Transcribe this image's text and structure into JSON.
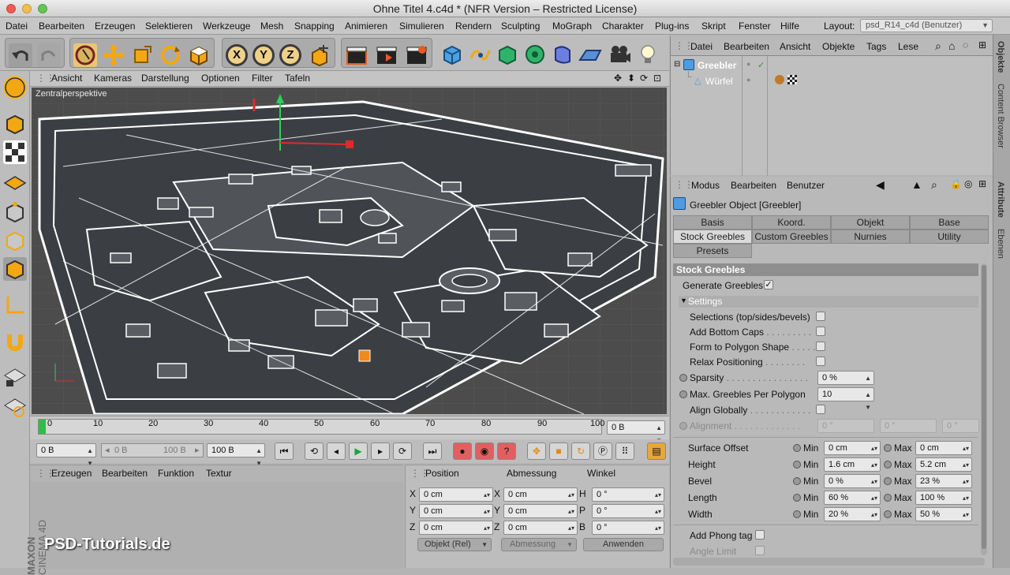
{
  "window": {
    "title": "Ohne Titel 4.c4d * (NFR Version – Restricted License)",
    "menu": [
      "Datei",
      "Bearbeiten",
      "Erzeugen",
      "Selektieren",
      "Werkzeuge",
      "Mesh",
      "Snapping",
      "Animieren",
      "Simulieren",
      "Rendern",
      "Sculpting",
      "MoGraph",
      "Charakter",
      "Plug-ins",
      "Skript",
      "Fenster",
      "Hilfe"
    ],
    "layout_label": "Layout:",
    "layout_value": "psd_R14_c4d (Benutzer)"
  },
  "toolbar": {
    "axis_x": "X",
    "axis_y": "Y",
    "axis_z": "Z"
  },
  "viewport": {
    "menu": [
      "Ansicht",
      "Kameras",
      "Darstellung",
      "Optionen",
      "Filter",
      "Tafeln"
    ],
    "label": "Zentralperspektive"
  },
  "timeline": {
    "ticks": [
      "0",
      "10",
      "20",
      "30",
      "40",
      "50",
      "60",
      "70",
      "80",
      "90",
      "100"
    ],
    "frame_display": "0 B"
  },
  "playback": {
    "start": "0 B",
    "range_min": "0 B",
    "range_max": "100 B",
    "end": "100 B"
  },
  "material_manager": {
    "menu": [
      "Erzeugen",
      "Bearbeiten",
      "Funktion",
      "Textur"
    ],
    "brand_line1": "MAXON",
    "brand_line2": "CINEMA 4D",
    "watermark": "PSD-Tutorials.de"
  },
  "coord_manager": {
    "headers": [
      "Position",
      "Abmessung",
      "Winkel"
    ],
    "rows": [
      {
        "pl": "X",
        "pv": "0 cm",
        "sl": "X",
        "sv": "0 cm",
        "al": "H",
        "av": "0 °"
      },
      {
        "pl": "Y",
        "pv": "0 cm",
        "sl": "Y",
        "sv": "0 cm",
        "al": "P",
        "av": "0 °"
      },
      {
        "pl": "Z",
        "pv": "0 cm",
        "sl": "Z",
        "sv": "0 cm",
        "al": "B",
        "av": "0 °"
      }
    ],
    "mode": "Objekt (Rel)",
    "size_mode": "Abmessung",
    "apply": "Anwenden"
  },
  "object_manager": {
    "menu": [
      "Datei",
      "Bearbeiten",
      "Ansicht",
      "Objekte",
      "Tags",
      "Lese"
    ],
    "objects": [
      {
        "name": "Greebler",
        "selected": true
      },
      {
        "name": "Würfel",
        "selected": false
      }
    ]
  },
  "attribute_manager": {
    "menu": [
      "Modus",
      "Bearbeiten",
      "Benutzer"
    ],
    "object_title": "Greebler Object [Greebler]",
    "tabs_row1": [
      "Basis",
      "Koord.",
      "Objekt",
      "Base"
    ],
    "tabs_row2": [
      "Stock Greebles",
      "Custom Greebles",
      "Nurnies",
      "Utility"
    ],
    "tabs_row3": [
      "Presets"
    ],
    "active_tab": "Stock Greebles",
    "section": "Stock Greebles",
    "generate_label": "Generate Greebles",
    "settings_label": "Settings",
    "options": [
      {
        "label": "Selections (top/sides/bevels)",
        "checked": false
      },
      {
        "label": "Add Bottom Caps",
        "checked": false
      },
      {
        "label": "Form to Polygon Shape",
        "checked": false
      },
      {
        "label": "Relax Positioning",
        "checked": false
      }
    ],
    "sparsity_label": "Sparsity",
    "sparsity_value": "0 %",
    "max_greebles_label": "Max. Greebles Per Polygon",
    "max_greebles_value": "10",
    "align_globally_label": "Align Globally",
    "alignment_label": "Alignment",
    "alignment_values": [
      "0 °",
      "0 °",
      "0 °"
    ],
    "min_label": "Min",
    "max_label": "Max",
    "ranges": [
      {
        "label": "Surface Offset",
        "min": "0 cm",
        "max": "0 cm"
      },
      {
        "label": "Height",
        "min": "1.6 cm",
        "max": "5.2 cm"
      },
      {
        "label": "Bevel",
        "min": "0 %",
        "max": "23 %"
      },
      {
        "label": "Length",
        "min": "60 %",
        "max": "100 %"
      },
      {
        "label": "Width",
        "min": "20 %",
        "max": "50 %"
      }
    ],
    "phong_label": "Add Phong tag",
    "angle_limit_label": "Angle Limit"
  },
  "side_tabs": [
    "Objekte",
    "Content Browser",
    "Attribute",
    "Ebenen"
  ]
}
